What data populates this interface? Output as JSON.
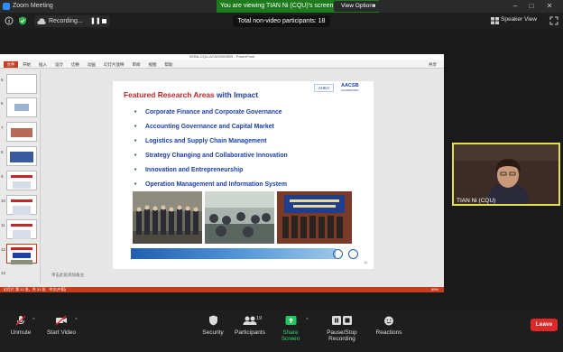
{
  "app": {
    "title": "Zoom Meeting"
  },
  "banner": {
    "viewing": "You are viewing TIAN Ni (CQU)'s screen",
    "view_options": "View Options"
  },
  "toolbar_top": {
    "recording": "Recording...",
    "participants_count": "Total non-video participants: 18",
    "speaker_view": "Speaker View"
  },
  "ppt": {
    "title": "SEBA-CQU-ACN00000805 - PowerPoint",
    "file_tab": "文件",
    "tabs": [
      "开始",
      "插入",
      "设计",
      "切换",
      "动画",
      "幻灯片放映",
      "审阅",
      "视图",
      "帮助"
    ],
    "share": "共享",
    "thumb_numbers": [
      "5",
      "6",
      "7",
      "8",
      "9",
      "10",
      "11",
      "12",
      "13"
    ],
    "active_thumb": "12",
    "notes_placeholder": "单击此处添加备注",
    "status": "幻灯片 第 12 张，共 31 张　中文(中国)",
    "zoom": "99%"
  },
  "slide": {
    "title_red": "Featured Research Areas ",
    "title_blue": "with Impact",
    "bullets": [
      "Corporate Finance and Corporate Governance",
      "Accounting Governance and Capital Market",
      "Logistics and Supply Chain Management",
      "Strategy Changing and Collaborative Innovation",
      "Innovation and Entrepreneurship",
      "Operation Management and Information System"
    ],
    "logo_left": "AHEA",
    "logo_right": "AACSB",
    "logo_right_sub": "ACCREDITED",
    "page_num": "12"
  },
  "participant": {
    "name": "TIAN Ni (CQU)"
  },
  "controls": {
    "unmute": "Unmute",
    "start_video": "Start Video",
    "security": "Security",
    "participants": "Participants",
    "participants_count": "19",
    "share_screen": "Share Screen",
    "pause_recording": "Pause/Stop Recording",
    "reactions": "Reactions",
    "leave": "Leave"
  },
  "colors": {
    "banner_green": "#1d7a1d",
    "slide_red": "#c0282a",
    "slide_blue": "#1c3fa0",
    "ppt_accent": "#c43e1c",
    "leave_red": "#e02828",
    "speaker_highlight": "#e3e14b"
  }
}
